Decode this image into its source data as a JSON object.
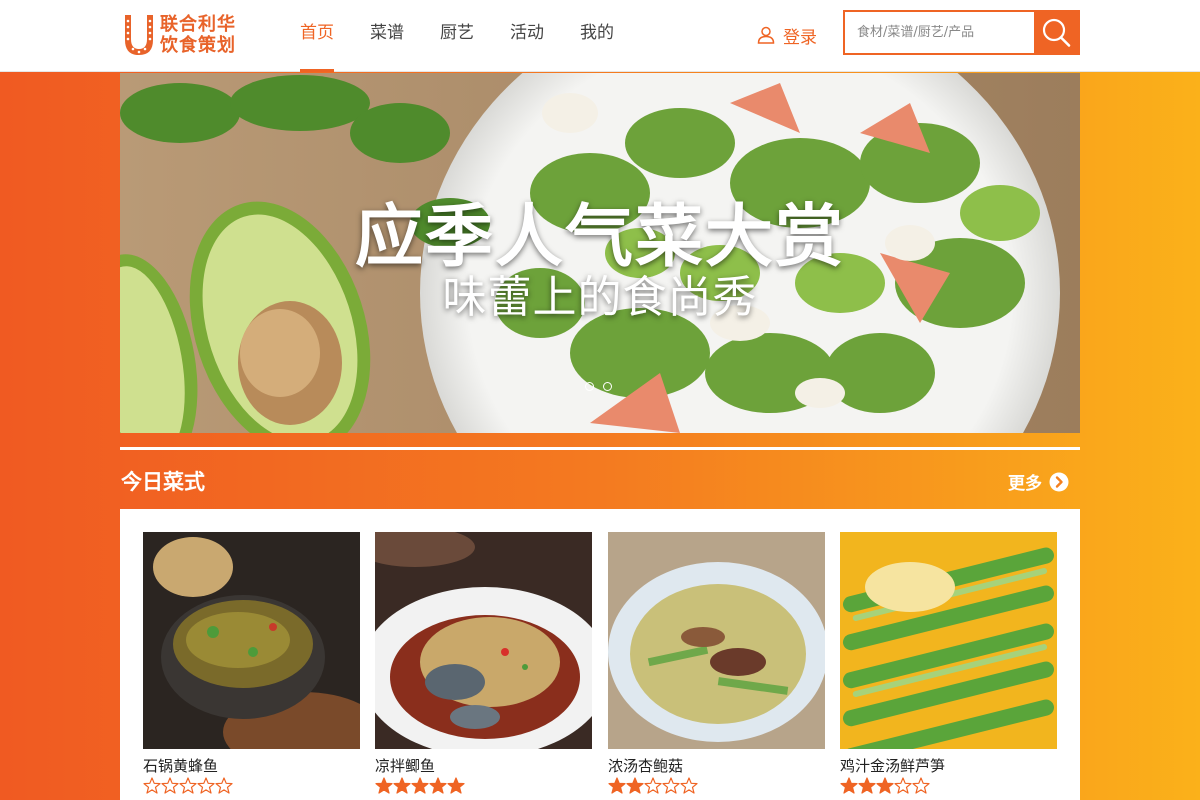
{
  "brand": {
    "line1": "联合利华",
    "line2": "饮食策划"
  },
  "nav": [
    {
      "label": "首页",
      "active": true
    },
    {
      "label": "菜谱",
      "active": false
    },
    {
      "label": "厨艺",
      "active": false
    },
    {
      "label": "活动",
      "active": false
    },
    {
      "label": "我的",
      "active": false
    }
  ],
  "login": {
    "label": "登录",
    "icon": "user-icon"
  },
  "search": {
    "placeholder": "食材/菜谱/厨艺/产品",
    "icon": "search-icon"
  },
  "banner": {
    "title": "应季人气菜大赏",
    "subtitle": "味蕾上的食尚秀",
    "slide_count": 2,
    "active_slide": 1
  },
  "section": {
    "title": "今日菜式",
    "more_label": "更多",
    "more_icon": "chevron-right-circle-icon"
  },
  "dishes": [
    {
      "name": "石锅黄蜂鱼",
      "rating": 0
    },
    {
      "name": "凉拌鲫鱼",
      "rating": 5
    },
    {
      "name": "浓汤杏鲍菇",
      "rating": 2
    },
    {
      "name": "鸡汁金汤鲜芦笋",
      "rating": 3
    }
  ],
  "colors": {
    "accent": "#ef6424",
    "gradient_start": "#f05a22",
    "gradient_end": "#fbb11a"
  }
}
